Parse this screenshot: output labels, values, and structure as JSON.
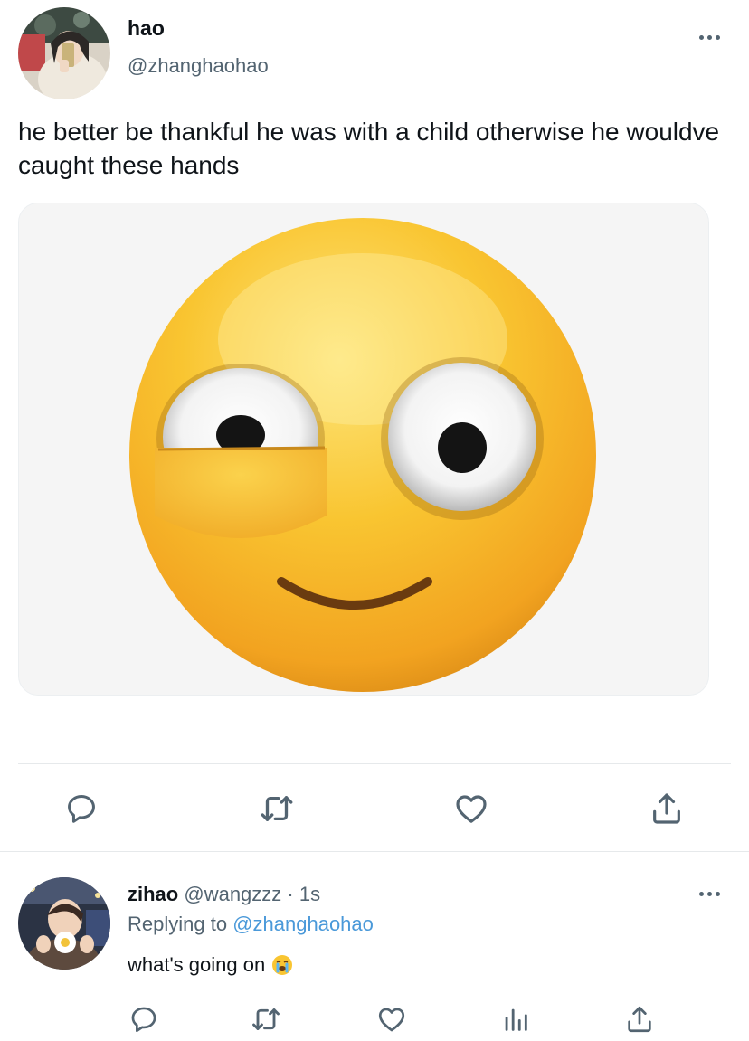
{
  "tweet": {
    "author_name": "hao",
    "author_handle": "@zhanghaohao",
    "text": "he better be thankful he was with a child otherwise he wouldve caught these hands",
    "more_icon": "more-dots-icon",
    "media_icon": "side-eye-emoji"
  },
  "actions": [
    "reply-icon",
    "retweet-icon",
    "like-icon",
    "share-icon"
  ],
  "reply": {
    "author_name": "zihao",
    "author_handle": "@wangzzz",
    "separator": "·",
    "time": "1s",
    "replying_prefix": "Replying to",
    "replying_handle": "@zhanghaohao",
    "text": "what's going on",
    "emoji": "loudly-crying-face-emoji",
    "actions": [
      "reply-icon",
      "retweet-icon",
      "like-icon",
      "analytics-icon",
      "share-icon"
    ]
  },
  "colors": {
    "link": "#4a99d9",
    "secondary_text": "#536471",
    "icon": "#536471",
    "emoji_yellow": "#f9c531"
  }
}
